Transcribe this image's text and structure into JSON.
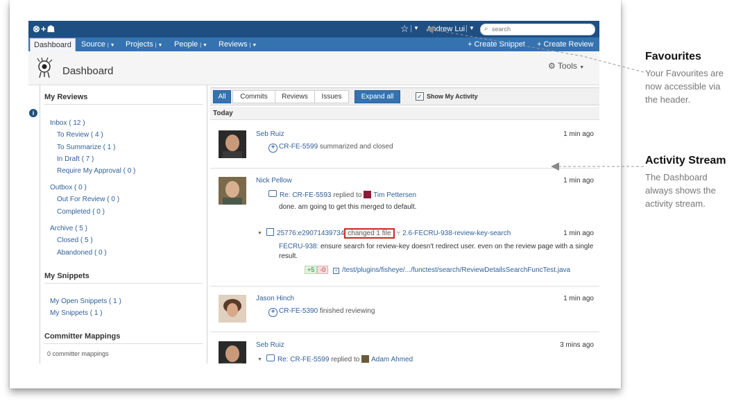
{
  "topbar": {
    "logo": "⊗+☗",
    "user": "Andrew Lui",
    "search_placeholder": "search"
  },
  "nav": {
    "items": [
      {
        "label": "Dashboard"
      },
      {
        "label": "Source"
      },
      {
        "label": "Projects"
      },
      {
        "label": "People"
      },
      {
        "label": "Reviews"
      }
    ],
    "create_snippet": "+ Create Snippet",
    "create_review": "+ Create Review"
  },
  "header": {
    "title": "Dashboard",
    "tools": "Tools"
  },
  "sidebar": {
    "my_reviews": "My Reviews",
    "inbox": "Inbox ( 12 )",
    "to_review": "To Review ( 4 )",
    "to_summarize": "To Summarize ( 1 )",
    "in_draft": "In Draft ( 7 )",
    "require_approval": "Require My Approval ( 0 )",
    "outbox": "Outbox ( 0 )",
    "out_for_review": "Out For Review ( 0 )",
    "completed": "Completed ( 0 )",
    "archive": "Archive ( 5 )",
    "closed": "Closed ( 5 )",
    "abandoned": "Abandoned ( 0 )",
    "my_snippets": "My Snippets",
    "my_open_snippets": "My Open Snippets ( 1 )",
    "my_snippets_count": "My Snippets ( 1 )",
    "committer_mappings": "Committer Mappings",
    "committer_count": "0  committer mappings"
  },
  "filters": {
    "all": "All",
    "commits": "Commits",
    "reviews": "Reviews",
    "issues": "Issues",
    "expand_all": "Expand all",
    "show_my_activity": "Show My Activity"
  },
  "stream": {
    "today": "Today",
    "e1": {
      "user": "Seb Ruiz",
      "time": "1 min ago",
      "review": "CR-FE-5599",
      "action": "summarized and closed"
    },
    "e2": {
      "user": "Nick Pellow",
      "time": "1 min ago",
      "reply_link": "Re: CR-FE-5593",
      "replied_to": "replied to",
      "target_user": "Tim Pettersen",
      "comment": "done. am going to get this merged to default.",
      "commit_id": "25776:e29071439734",
      "changed": "changed 1 file",
      "branch": "2.6-FECRU-938-review-key-search",
      "commit_time": "1 min ago",
      "issue_key": "FECRU-938:",
      "issue_text": "ensure search for review-key doesn't redirect user. even on the review page with a single",
      "issue_text2": "result.",
      "plus": "+5",
      "minus": "-0",
      "file_path": "/test/plugins/fisheye/.../functest/search/ReviewDetailsSearchFuncTest.java"
    },
    "e3": {
      "user": "Jason Hinch",
      "time": "1 min ago",
      "review": "CR-FE-5390",
      "action": "finished reviewing"
    },
    "e4": {
      "user": "Seb Ruiz",
      "time": "3 mins ago",
      "reply_link": "Re: CR-FE-5599",
      "replied_to": "replied to",
      "target_user": "Adam Ahmed"
    }
  },
  "annotations": {
    "favourites_title": "Favourites",
    "favourites_line1": "Your Favourites are",
    "favourites_line2": "now accessible via",
    "favourites_line3": "the header.",
    "activity_title": "Activity Stream",
    "activity_line1": "The Dashboard",
    "activity_line2": "always shows the",
    "activity_line3": "activity stream."
  },
  "colors": {
    "topbar": "#1f4f82",
    "nav": "#3572b0",
    "link": "#2f5f9a",
    "highlight": "#d52424"
  }
}
